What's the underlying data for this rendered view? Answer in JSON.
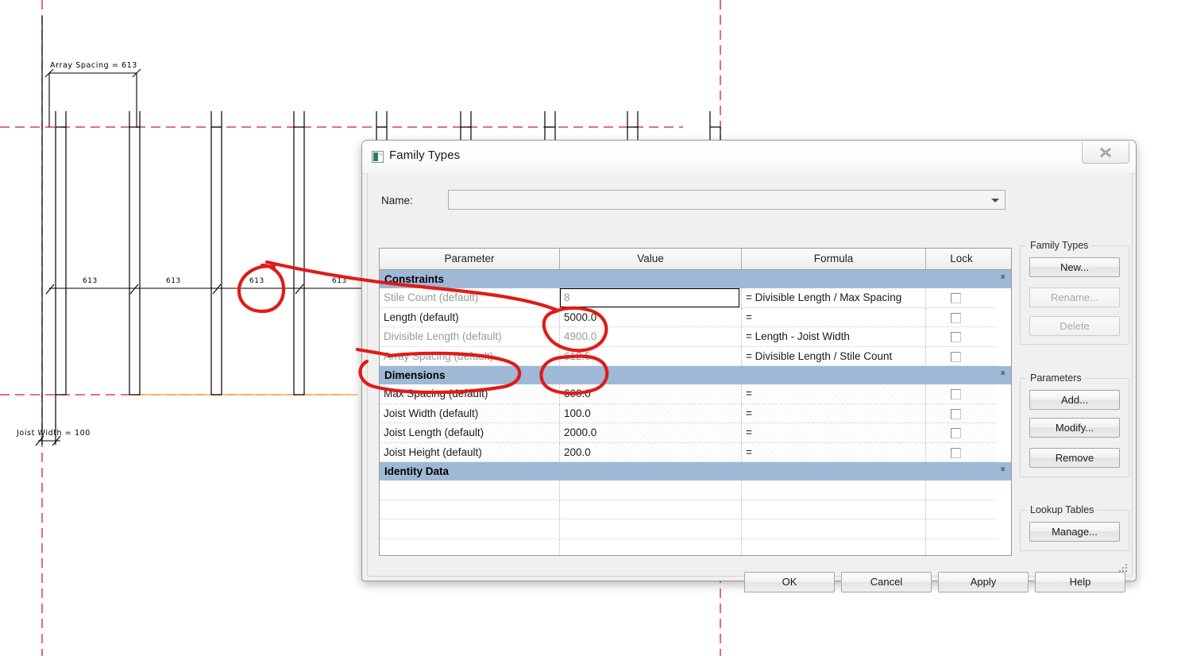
{
  "drawing": {
    "labels": {
      "array_spacing": "Array Spacing = 613",
      "joist_width": "Joist Width = 100"
    },
    "chain_dimensions": [
      "613",
      "613",
      "613",
      "613"
    ]
  },
  "dialog": {
    "title": "Family Types",
    "close_icon": "close-icon",
    "name_label": "Name:",
    "name_value": "",
    "grid": {
      "headers": {
        "parameter": "Parameter",
        "value": "Value",
        "formula": "Formula",
        "lock": "Lock"
      },
      "sections": [
        {
          "name": "Constraints",
          "collapsed": false,
          "chevron": "«",
          "rows": [
            {
              "parameter": "Stile Count (default)",
              "value": "8",
              "formula": "= Divisible Length / Max Spacing",
              "disabled": true,
              "selected": true
            },
            {
              "parameter": "Length (default)",
              "value": "5000.0",
              "formula": "=",
              "disabled": false,
              "selected": false
            },
            {
              "parameter": "Divisible Length (default)",
              "value": "4900.0",
              "formula": "= Length - Joist Width",
              "disabled": true,
              "selected": false
            },
            {
              "parameter": "Array Spacing (default)",
              "value": "612.5",
              "formula": "= Divisible Length / Stile Count",
              "disabled": true,
              "selected": false
            }
          ]
        },
        {
          "name": "Dimensions",
          "collapsed": false,
          "chevron": "«",
          "rows": [
            {
              "parameter": "Max Spacing (default)",
              "value": "600.0",
              "formula": "=",
              "disabled": false,
              "selected": false
            },
            {
              "parameter": "Joist Width (default)",
              "value": "100.0",
              "formula": "=",
              "disabled": false,
              "selected": false
            },
            {
              "parameter": "Joist Length (default)",
              "value": "2000.0",
              "formula": "=",
              "disabled": false,
              "selected": false
            },
            {
              "parameter": "Joist Height (default)",
              "value": "200.0",
              "formula": "=",
              "disabled": false,
              "selected": false
            }
          ]
        },
        {
          "name": "Identity Data",
          "collapsed": true,
          "chevron": "»",
          "rows": []
        }
      ]
    },
    "side_panel": {
      "family_types": {
        "title": "Family Types",
        "buttons": [
          {
            "label": "New...",
            "disabled": false
          },
          {
            "label": "Rename...",
            "disabled": true
          },
          {
            "label": "Delete",
            "disabled": true
          }
        ]
      },
      "parameters": {
        "title": "Parameters",
        "buttons": [
          {
            "label": "Add...",
            "disabled": false
          },
          {
            "label": "Modify...",
            "disabled": false
          },
          {
            "label": "Remove",
            "disabled": false
          }
        ]
      },
      "lookup_tables": {
        "title": "Lookup Tables",
        "buttons": [
          {
            "label": "Manage...",
            "disabled": false
          }
        ]
      }
    },
    "footer_buttons": [
      {
        "label": "OK"
      },
      {
        "label": "Cancel"
      },
      {
        "label": "Apply"
      },
      {
        "label": "Help"
      }
    ]
  },
  "colors": {
    "section_header_blue": "#9fb8d6",
    "annotation_red": "#e01b17",
    "construction_red": "#cc2222",
    "reference_orange": "#f0a030",
    "title_icon_green": "#2e7d5b"
  }
}
